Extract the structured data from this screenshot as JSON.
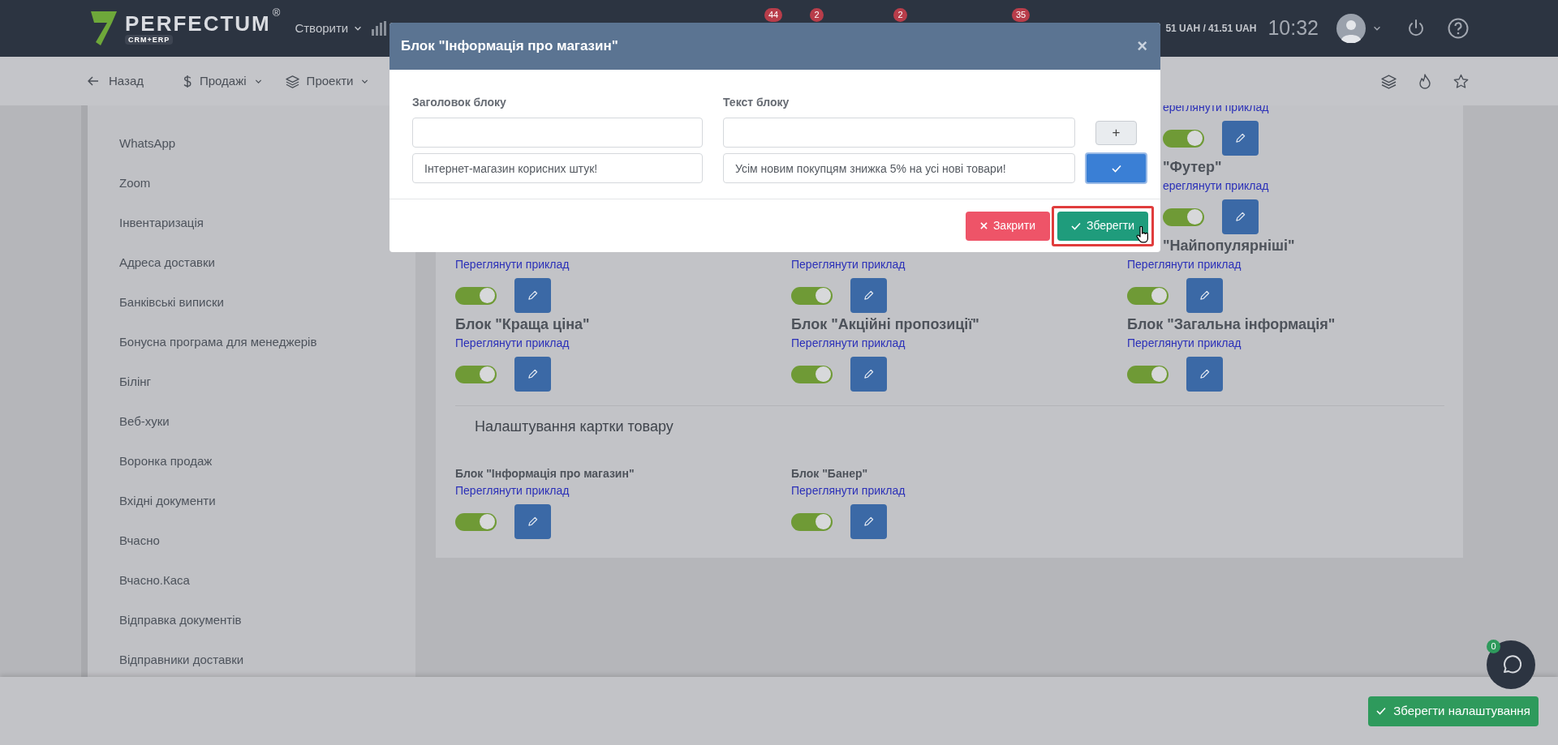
{
  "header": {
    "logo": {
      "wordmark": "PERFECTUM",
      "mark": "®",
      "tagline": "CRM+ERP"
    },
    "create_menu": "Створити",
    "badges": [
      "44",
      "2",
      "2",
      "35"
    ],
    "balance": "51 UAH / 41.51 UAH",
    "clock": "10:32"
  },
  "nav": {
    "back": "Назад",
    "menus": [
      "Продажі",
      "Проекти"
    ]
  },
  "sidebar": {
    "items": [
      "WhatsApp",
      "Zoom",
      "Інвентаризація",
      "Адреса доставки",
      "Банківські виписки",
      "Бонусна програма для менеджерів",
      "Білінг",
      "Веб-хуки",
      "Воронка продаж",
      "Вхідні документи",
      "Вчасно",
      "Вчасно.Каса",
      "Відправка документів",
      "Відправники доставки"
    ]
  },
  "store_blocks": {
    "rows": [
      [
        null,
        null,
        {
          "link": "ереглянути приклад",
          "on": true
        }
      ],
      [
        null,
        null,
        {
          "title": "\"Футер\"",
          "link": "ереглянути приклад",
          "on": true
        }
      ],
      [
        {
          "link": "Переглянути приклад",
          "on": true
        },
        {
          "link": "Переглянути приклад",
          "on": true
        },
        {
          "title": "\"Найпопулярніші\"",
          "link": "Переглянути приклад",
          "on": true
        }
      ],
      [
        {
          "title": "Блок \"Краща ціна\"",
          "link": "Переглянути приклад",
          "on": true
        },
        {
          "title": "Блок \"Акційні пропозиції\"",
          "link": "Переглянути приклад",
          "on": true
        },
        {
          "title": "Блок \"Загальна інформація\"",
          "link": "Переглянути приклад",
          "on": true
        }
      ]
    ]
  },
  "product_card": {
    "heading": "Налаштування картки товару",
    "blocks": [
      {
        "title": "Блок \"Інформація про магазин\"",
        "link": "Переглянути приклад",
        "on": true
      },
      {
        "title": "Блок \"Банер\"",
        "link": "Переглянути приклад",
        "on": true
      }
    ]
  },
  "modal": {
    "title": "Блок \"Інформація про магазин\"",
    "close": "×",
    "columns": [
      "Заголовок блоку",
      "Текст блоку"
    ],
    "rows": [
      {
        "kind": "new",
        "add": "+"
      },
      {
        "kind": "saved",
        "heading": "Інтернет-магазин корисних штук!",
        "text": "Усім новим покупцям знижка 5% на усі нові товари!"
      }
    ],
    "buttons": {
      "close": "Закрити",
      "save": "Зберегти"
    }
  },
  "footer": {
    "save": "Зберегти налаштування",
    "chat_badge": "0"
  }
}
